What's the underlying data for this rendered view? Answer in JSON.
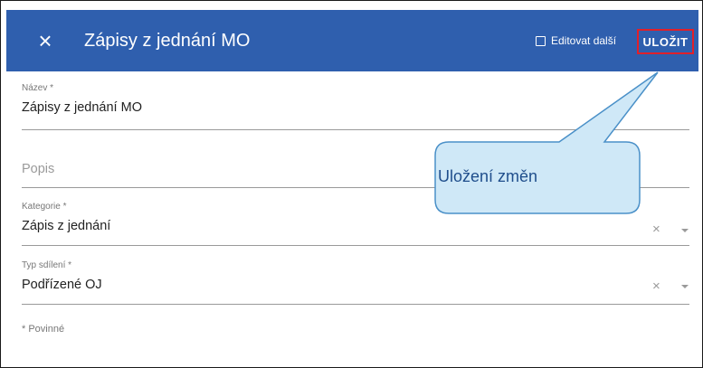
{
  "header": {
    "close_icon": "close-icon",
    "title": "Zápisy z jednání MO",
    "edit_next_label": "Editovat další",
    "save_label": "ULOŽIT"
  },
  "form": {
    "name": {
      "label": "Název *",
      "value": "Zápisy z jednání MO"
    },
    "description": {
      "placeholder": "Popis"
    },
    "category": {
      "label": "Kategorie *",
      "value": "Zápis z jednání"
    },
    "sharing_type": {
      "label": "Typ sdílení *",
      "value": "Podřízené OJ"
    },
    "required_note": "* Povinné"
  },
  "callout": {
    "text": "Uložení změn"
  },
  "colors": {
    "header_bg": "#2f5fae",
    "highlight_border": "#e0202a",
    "callout_fill": "#cfe8f7",
    "callout_stroke": "#4a90c8"
  }
}
